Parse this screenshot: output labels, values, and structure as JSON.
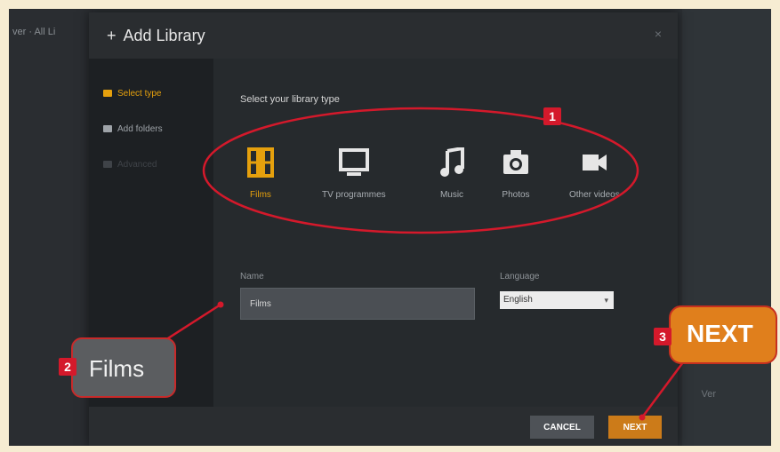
{
  "background": {
    "breadcrumb": "ver · All Li",
    "right_text": "Ver"
  },
  "modal": {
    "title": "Add Library",
    "plus_icon": "+",
    "close_icon": "×"
  },
  "sidebar": {
    "items": [
      {
        "label": "Select type",
        "icon": "library-icon"
      },
      {
        "label": "Add folders",
        "icon": "folder-icon"
      },
      {
        "label": "Advanced",
        "icon": "gear-icon"
      }
    ]
  },
  "content": {
    "prompt": "Select your library type",
    "types": [
      {
        "label": "Films",
        "icon": "film-icon",
        "selected": true
      },
      {
        "label": "TV programmes",
        "icon": "tv-icon"
      },
      {
        "label": "Music",
        "icon": "music-icon"
      },
      {
        "label": "Photos",
        "icon": "camera-icon"
      },
      {
        "label": "Other videos",
        "icon": "video-camera-icon"
      }
    ],
    "name_label": "Name",
    "name_value": "Films",
    "language_label": "Language",
    "language_value": "English"
  },
  "footer": {
    "cancel_label": "CANCEL",
    "next_label": "NEXT"
  },
  "annotations": {
    "badge1": "1",
    "badge2": "2",
    "badge3": "3",
    "films_callout": "Films",
    "next_callout": "NEXT"
  },
  "colors": {
    "accent": "#e5a00d",
    "next_button": "#cc7b19",
    "annotation_red": "#d4192b"
  }
}
